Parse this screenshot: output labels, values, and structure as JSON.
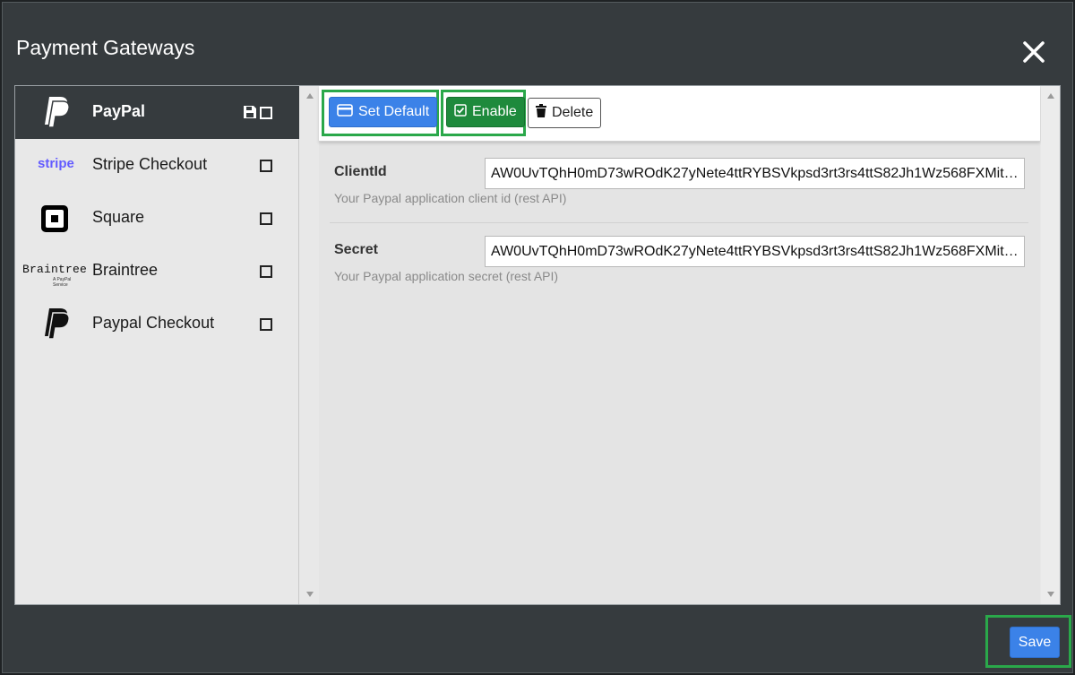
{
  "dialog": {
    "title": "Payment Gateways",
    "close_icon": "close-icon"
  },
  "sidebar": {
    "items": [
      {
        "label": "PayPal",
        "logo": "paypal-logo",
        "active": true,
        "checked": false,
        "has_save_icon": true
      },
      {
        "label": "Stripe Checkout",
        "logo": "stripe-logo",
        "logo_text": "stripe",
        "active": false,
        "checked": false
      },
      {
        "label": "Square",
        "logo": "square-logo",
        "active": false,
        "checked": false
      },
      {
        "label": "Braintree",
        "logo": "braintree-logo",
        "logo_text": "Braintree",
        "logo_subtext": "A PayPal Service",
        "active": false,
        "checked": false
      },
      {
        "label": "Paypal Checkout",
        "logo": "paypal-logo",
        "active": false,
        "checked": false
      }
    ]
  },
  "toolbar": {
    "set_default_label": "Set Default",
    "set_default_icon": "credit-card-icon",
    "enable_label": "Enable",
    "enable_icon": "checkbox-checked-icon",
    "delete_label": "Delete",
    "delete_icon": "trash-icon"
  },
  "form": {
    "client_id": {
      "label": "ClientId",
      "value": "AW0UvTQhH0mD73wROdK27yNete4ttRYBSVkpsd3rt3rs4ttS82Jh1Wz568FXMiti…",
      "help": "Your Paypal application client id (rest API)"
    },
    "secret": {
      "label": "Secret",
      "value": "AW0UvTQhH0mD73wROdK27yNete4ttRYBSVkpsd3rt3rs4ttS82Jh1Wz568FXMiti…",
      "help": "Your Paypal application secret (rest API)"
    }
  },
  "footer": {
    "save_label": "Save"
  },
  "colors": {
    "dialog_bg": "#363b3e",
    "primary": "#3b82e8",
    "success": "#1e8a3c",
    "highlight": "#2aa84a"
  }
}
